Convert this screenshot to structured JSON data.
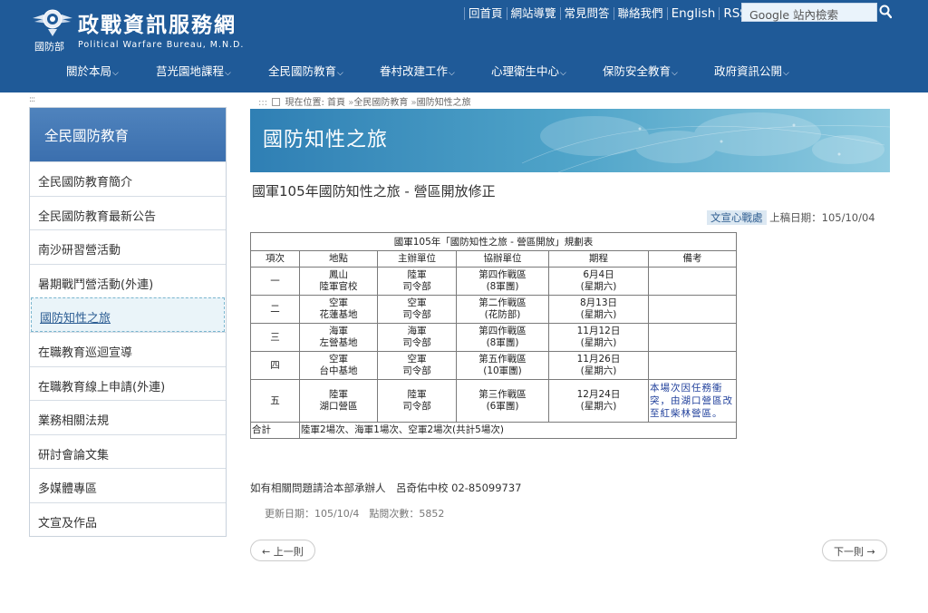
{
  "site": {
    "emblem_label": "國防部",
    "title": "政戰資訊服務網",
    "subtitle": "Political Warfare Bureau, M.N.D."
  },
  "toplinks": [
    "回首頁",
    "網站導覽",
    "常見問答",
    "聯絡我們",
    "English",
    "RSS"
  ],
  "search": {
    "placeholder": "Google 站內檢索"
  },
  "nav": [
    "關於本局",
    "莒光園地課程",
    "全民國防教育",
    "眷村改建工作",
    "心理衛生中心",
    "保防安全教育",
    "政府資訊公開"
  ],
  "sidebar": {
    "heading": "全民國防教育",
    "items": [
      {
        "label": "全民國防教育簡介"
      },
      {
        "label": "全民國防教育最新公告"
      },
      {
        "label": "南沙研習營活動"
      },
      {
        "label": "暑期戰鬥營活動(外連)"
      },
      {
        "label": "國防知性之旅"
      },
      {
        "label": "在職教育巡迴宣導"
      },
      {
        "label": "在職教育線上申請(外連)"
      },
      {
        "label": "業務相關法規"
      },
      {
        "label": "研討會論文集"
      },
      {
        "label": "多媒體專區"
      },
      {
        "label": "文宣及作品"
      }
    ],
    "active_index": 4
  },
  "breadcrumb": {
    "prefix": "現在位置:",
    "items": [
      "首頁",
      "全民國防教育",
      "國防知性之旅"
    ]
  },
  "banner": {
    "title": "國防知性之旅"
  },
  "article": {
    "title": "國軍105年國防知性之旅 - 營區開放修正",
    "unit": "文宣心戰處",
    "date_label": "上稿日期：105/10/04"
  },
  "table": {
    "caption": "國軍105年「國防知性之旅 - 營區開放」規劃表",
    "headers": [
      "項次",
      "地點",
      "主辦單位",
      "協辦單位",
      "期程",
      "備考"
    ],
    "rows": [
      {
        "no": "一",
        "place1": "鳳山",
        "place2": "陸軍官校",
        "host1": "陸軍",
        "host2": "司令部",
        "co1": "第四作戰區",
        "co2": "(8軍團)",
        "date1": "6月4日",
        "date2": "(星期六)",
        "note": ""
      },
      {
        "no": "二",
        "place1": "空軍",
        "place2": "花蓮基地",
        "host1": "空軍",
        "host2": "司令部",
        "co1": "第二作戰區",
        "co2": "(花防部)",
        "date1": "8月13日",
        "date2": "(星期六)",
        "note": ""
      },
      {
        "no": "三",
        "place1": "海軍",
        "place2": "左營基地",
        "host1": "海軍",
        "host2": "司令部",
        "co1": "第四作戰區",
        "co2": "(8軍團)",
        "date1": "11月12日",
        "date2": "(星期六)",
        "note": ""
      },
      {
        "no": "四",
        "place1": "空軍",
        "place2": "台中基地",
        "host1": "空軍",
        "host2": "司令部",
        "co1": "第五作戰區",
        "co2": "(10軍團)",
        "date1": "11月26日",
        "date2": "(星期六)",
        "note": ""
      },
      {
        "no": "五",
        "place1": "陸軍",
        "place2": "湖口營區",
        "host1": "陸軍",
        "host2": "司令部",
        "co1": "第三作戰區",
        "co2": "(6軍團)",
        "date1": "12月24日",
        "date2": "(星期六)",
        "note": "本場次因任務衝突，由湖口營區改至紅柴林營區。"
      }
    ],
    "total_label": "合計",
    "total_text": "陸軍2場次、海軍1場次、空軍2場次(共計5場次)"
  },
  "contact": "如有相關問題請洽本部承辦人　呂奇佑中校 02-85099737",
  "updated": "更新日期：105/10/4　點閱次數：5852",
  "pager": {
    "prev": "← 上一則",
    "next": "下一則 →"
  },
  "colors": {
    "header_bg": "#1f5a98",
    "sidebar_head": "#3b6fae",
    "note_text": "#1f3f9b"
  }
}
